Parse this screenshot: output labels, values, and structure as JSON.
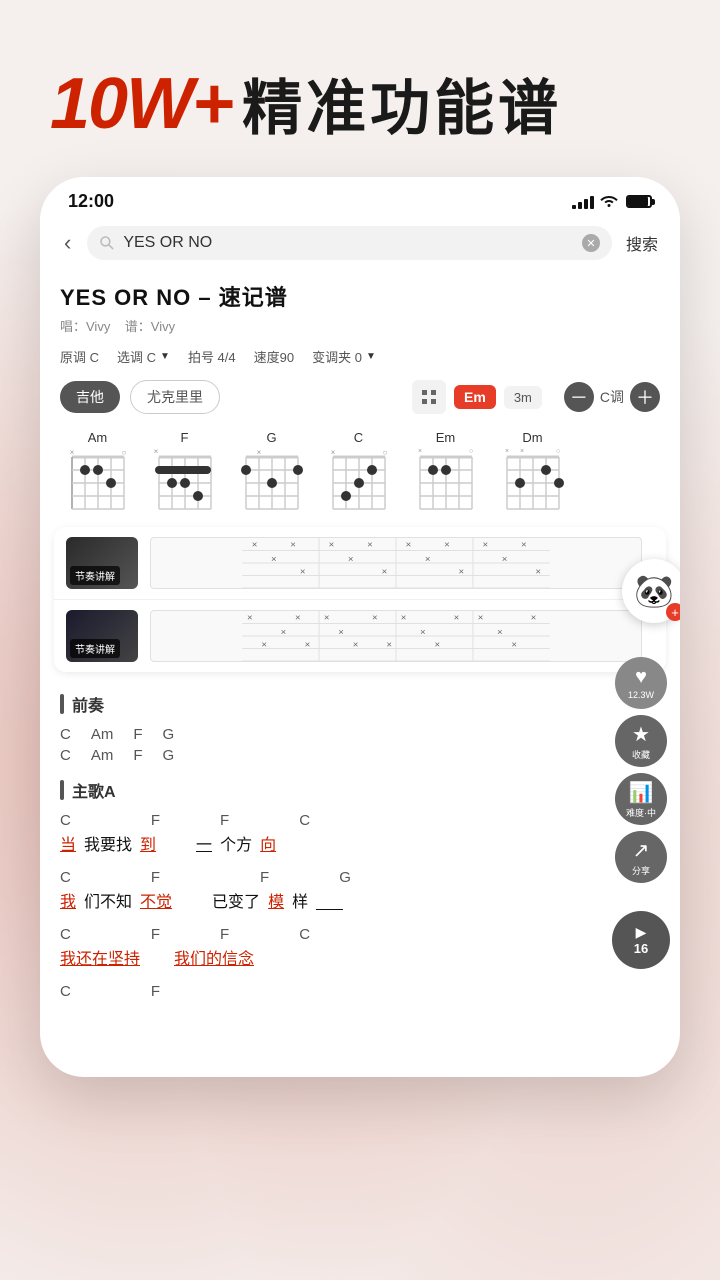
{
  "app": {
    "title_logo": "10W+",
    "title_plus": "",
    "title_text": "精准功能谱"
  },
  "status_bar": {
    "time": "12:00",
    "signal": "full",
    "wifi": true,
    "battery": "full"
  },
  "search": {
    "query": "YES OR NO",
    "placeholder": "搜索",
    "button_label": "搜索",
    "back_label": "‹"
  },
  "song": {
    "title": "YES OR NO – 速记谱",
    "singer_label": "唱：Vivy",
    "composer_label": "谱：Vivy",
    "original_key": "原调 C",
    "selected_key": "选调 C",
    "time_sig": "拍号 4/4",
    "tempo": "速度90",
    "capo": "变调夹 0"
  },
  "instruments": [
    {
      "label": "吉他",
      "active": true
    },
    {
      "label": "尤克里里",
      "active": false
    }
  ],
  "chord_controls": {
    "grid_icon": "⊞",
    "chord_badge": "Em",
    "time_badge": "3m",
    "minus_btn": "－",
    "tuning_label": "C调",
    "plus_btn": "＋"
  },
  "chords": [
    {
      "name": "Am"
    },
    {
      "name": "F"
    },
    {
      "name": "G"
    },
    {
      "name": "C"
    },
    {
      "name": "Em"
    },
    {
      "name": "Dm"
    }
  ],
  "tutorials": [
    {
      "label": "节奏讲解"
    },
    {
      "label": "节奏讲解"
    }
  ],
  "sidebar_actions": [
    {
      "icon": "♥",
      "label": "12.3W",
      "color": "#888"
    },
    {
      "icon": "★",
      "label": "收藏",
      "color": "#666"
    },
    {
      "icon": "📊",
      "label": "难度·中",
      "color": "#666"
    },
    {
      "icon": "↗",
      "label": "分享",
      "color": "#666"
    }
  ],
  "play_button": {
    "icon": "▶",
    "number": "16"
  },
  "sheet": {
    "sections": [
      {
        "name": "前奏",
        "lines": [
          {
            "chords": [
              "C",
              "Am",
              "F",
              "G"
            ],
            "lyrics": []
          },
          {
            "chords": [
              "C",
              "Am",
              "F",
              "G"
            ],
            "lyrics": []
          }
        ]
      },
      {
        "name": "主歌A",
        "lines": [
          {
            "chords": [
              "C",
              "",
              "F",
              "F",
              "",
              "C"
            ],
            "lyrics": [
              "当我要找",
              "到",
              "",
              "一个方",
              "向"
            ]
          },
          {
            "chords": [
              "C",
              "",
              "F",
              "",
              "",
              "F",
              "G"
            ],
            "lyrics": [
              "我们不知",
              "不觉",
              "",
              "已变了",
              "模样",
              "___"
            ]
          },
          {
            "chords": [
              "C",
              "",
              "F",
              "F",
              "",
              "C"
            ],
            "lyrics": [
              "我还在坚持",
              "",
              "我们的信念"
            ]
          }
        ]
      }
    ]
  },
  "bottom_section_hint": {
    "chords_partial": [
      "C",
      "",
      "F"
    ]
  }
}
